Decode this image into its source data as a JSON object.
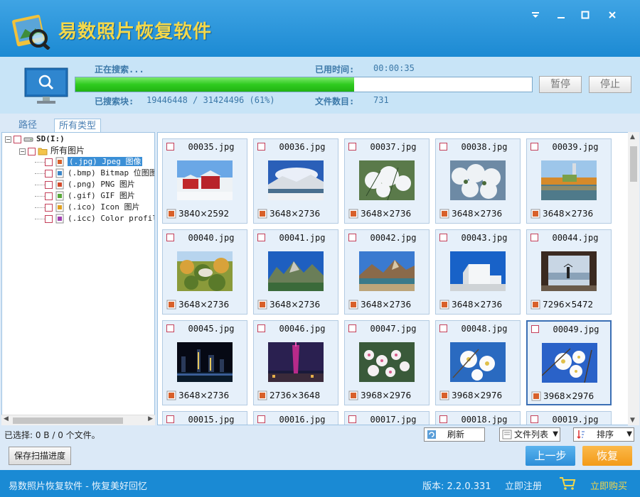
{
  "app": {
    "title": "易数照片恢复软件"
  },
  "window_controls": [
    "menu-icon",
    "minimize-icon",
    "maximize-icon",
    "close-icon"
  ],
  "progress": {
    "status_label": "正在搜索...",
    "elapsed_label": "已用时间:",
    "elapsed_value": "00:00:35",
    "blocks_label": "已搜索块:",
    "blocks_value": "19446448 / 31424496 (61%)",
    "files_label": "文件数目:",
    "files_value": "731",
    "percent": 61,
    "pause_label": "暂停",
    "stop_label": "停止"
  },
  "tabs": [
    {
      "label": "路径"
    },
    {
      "label": "所有类型"
    }
  ],
  "tree": {
    "drive": "SD(I:)",
    "root": "所有图片",
    "items": [
      {
        "label": "(.jpg) Jpeg 图像",
        "icon": "jpg-file-icon"
      },
      {
        "label": "(.bmp) Bitmap 位图图",
        "icon": "bmp-file-icon"
      },
      {
        "label": "(.png) PNG 图片",
        "icon": "png-file-icon"
      },
      {
        "label": "(.gif) GIF 图片",
        "icon": "gif-file-icon"
      },
      {
        "label": "(.ico) Icon 图片",
        "icon": "ico-file-icon"
      },
      {
        "label": "(.icc) Color profile",
        "icon": "icc-file-icon"
      }
    ]
  },
  "files": [
    {
      "name": "00035.jpg",
      "dims": "3840×2592",
      "scene": "snow-red-buildings"
    },
    {
      "name": "00036.jpg",
      "dims": "3648×2736",
      "scene": "snow-mountain-lake"
    },
    {
      "name": "00037.jpg",
      "dims": "3648×2736",
      "scene": "snow-pine"
    },
    {
      "name": "00038.jpg",
      "dims": "3648×2736",
      "scene": "snow-trees"
    },
    {
      "name": "00039.jpg",
      "dims": "3648×2736",
      "scene": "autumn-lake-tower"
    },
    {
      "name": "00040.jpg",
      "dims": "3648×2736",
      "scene": "autumn-park"
    },
    {
      "name": "00041.jpg",
      "dims": "3648×2736",
      "scene": "rocky-hills"
    },
    {
      "name": "00042.jpg",
      "dims": "3648×2736",
      "scene": "rocky-lake"
    },
    {
      "name": "00043.jpg",
      "dims": "3648×2736",
      "scene": "white-building"
    },
    {
      "name": "00044.jpg",
      "dims": "7296×5472",
      "scene": "sea-window"
    },
    {
      "name": "00045.jpg",
      "dims": "3648×2736",
      "scene": "city-night"
    },
    {
      "name": "00046.jpg",
      "dims": "2736×3648",
      "scene": "canton-tower"
    },
    {
      "name": "00047.jpg",
      "dims": "3968×2976",
      "scene": "cherry-blossom"
    },
    {
      "name": "00048.jpg",
      "dims": "3968×2976",
      "scene": "white-flowers"
    },
    {
      "name": "00049.jpg",
      "dims": "3968×2976",
      "scene": "white-flowers-sky"
    },
    {
      "name": "00015.jpg",
      "dims": "",
      "scene": ""
    },
    {
      "name": "00016.jpg",
      "dims": "",
      "scene": ""
    },
    {
      "name": "00017.jpg",
      "dims": "",
      "scene": ""
    },
    {
      "name": "00018.jpg",
      "dims": "",
      "scene": ""
    },
    {
      "name": "00019.jpg",
      "dims": "",
      "scene": ""
    }
  ],
  "selected_file": "00049.jpg",
  "toolbar": {
    "selection_info": "已选择: 0 B / 0 个文件。",
    "refresh_label": "刷新",
    "view_label": "文件列表",
    "sort_label": "排序"
  },
  "actions": {
    "save_progress_label": "保存扫描进度",
    "back_label": "上一步",
    "recover_label": "恢复"
  },
  "status": {
    "slogan": "易数照片恢复软件 - 恢复美好回忆",
    "version": "版本: 2.2.0.331",
    "register_label": "立即注册",
    "buy_label": "立即购买"
  },
  "colors": {
    "accent": "#1a8ad4",
    "progress_green": "#2fcb1f",
    "recover_orange": "#f5a020",
    "back_blue": "#3c9ee3"
  }
}
